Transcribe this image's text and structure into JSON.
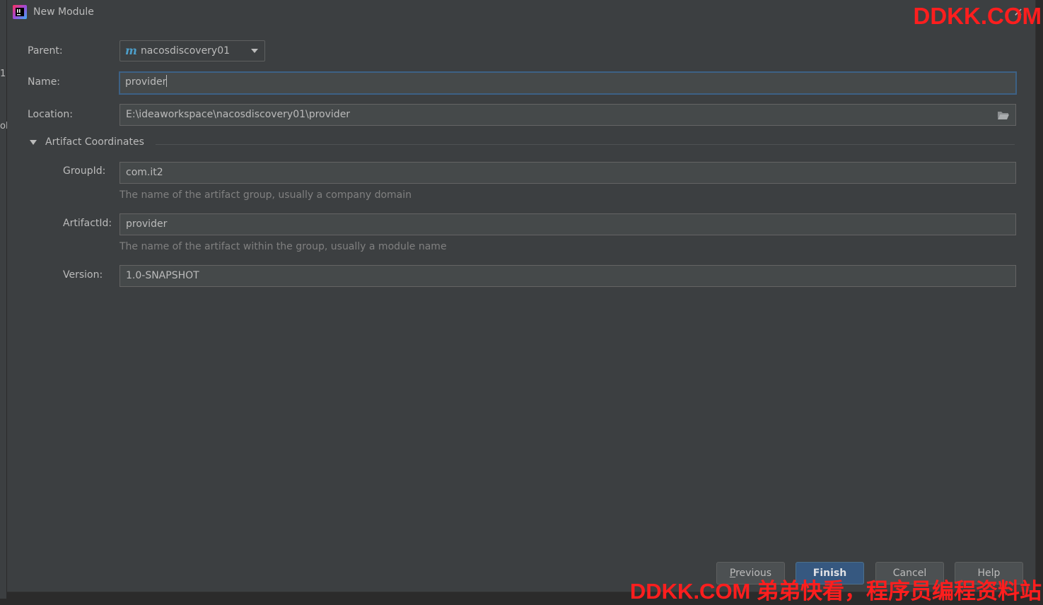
{
  "window": {
    "title": "New Module"
  },
  "form": {
    "parent_label": "Parent:",
    "parent_value": "nacosdiscovery01",
    "parent_icon": "maven-m-icon",
    "name_label": "Name:",
    "name_value": "provider",
    "location_label": "Location:",
    "location_value": "E:\\ideaworkspace\\nacosdiscovery01\\provider"
  },
  "artifact": {
    "section_title": "Artifact Coordinates",
    "groupid_label": "GroupId:",
    "groupid_value": "com.it2",
    "groupid_hint": "The name of the artifact group, usually a company domain",
    "artifactid_label": "ArtifactId:",
    "artifactid_value": "provider",
    "artifactid_hint": "The name of the artifact within the group, usually a module name",
    "version_label": "Version:",
    "version_value": "1.0-SNAPSHOT"
  },
  "buttons": {
    "previous_first": "P",
    "previous_rest": "revious",
    "finish": "Finish",
    "cancel": "Cancel",
    "help": "Help"
  },
  "watermark": {
    "top": "DDKK.COM",
    "bottom": "DDKK.COM 弟弟快看，程序员编程资料站"
  },
  "background": {
    "left_edge_chars": [
      "1",
      "ol"
    ]
  },
  "colors": {
    "dialog_bg": "#3c3f41",
    "field_bg": "#45494a",
    "focus_border": "#3d6185",
    "primary_button": "#365880",
    "maven_icon": "#4d9ec9",
    "watermark": "#ff1e1e"
  }
}
